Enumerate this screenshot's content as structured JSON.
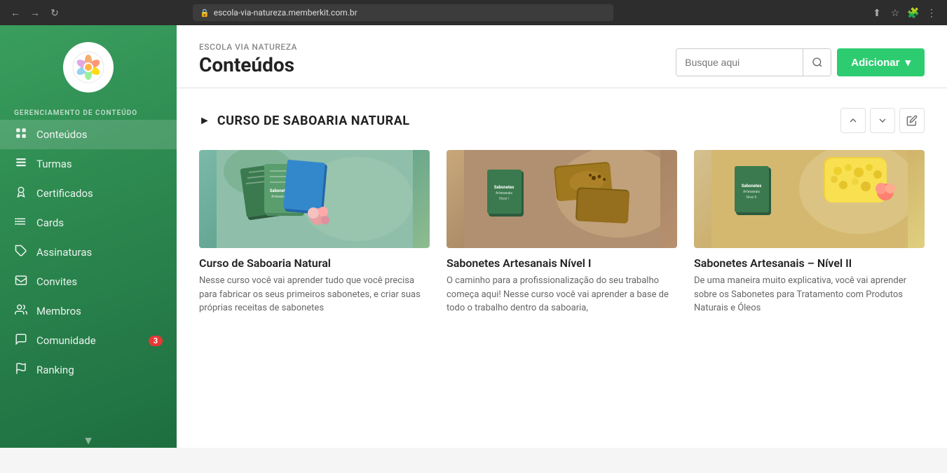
{
  "browser": {
    "url": "escola-via-natureza.memberkit.com.br",
    "lock_icon": "🔒"
  },
  "sidebar": {
    "section_label": "GERENCIAMENTO DE CONTEÚDO",
    "logo_alt": "Via Natureza",
    "nav_items": [
      {
        "id": "conteudos",
        "label": "Conteúdos",
        "icon": "grid",
        "active": true,
        "badge": null
      },
      {
        "id": "turmas",
        "label": "Turmas",
        "icon": "list",
        "active": false,
        "badge": null
      },
      {
        "id": "certificados",
        "label": "Certificados",
        "icon": "award",
        "active": false,
        "badge": null
      },
      {
        "id": "cards",
        "label": "Cards",
        "icon": "users2",
        "active": false,
        "badge": null
      },
      {
        "id": "assinaturas",
        "label": "Assinaturas",
        "icon": "tag",
        "active": false,
        "badge": null
      },
      {
        "id": "convites",
        "label": "Convites",
        "icon": "mail",
        "active": false,
        "badge": null
      },
      {
        "id": "membros",
        "label": "Membros",
        "icon": "people",
        "active": false,
        "badge": null
      },
      {
        "id": "comunidade",
        "label": "Comunidade",
        "icon": "chat",
        "active": false,
        "badge": "3"
      },
      {
        "id": "ranking",
        "label": "Ranking",
        "icon": "flag",
        "active": false,
        "badge": null
      }
    ]
  },
  "header": {
    "school_name": "ESCOLA VIA NATUREZA",
    "page_title": "Conteúdos",
    "search_placeholder": "Busque aqui",
    "add_button_label": "Adicionar"
  },
  "section": {
    "title": "CURSO DE SABOARIA NATURAL",
    "up_label": "↑",
    "down_label": "↓",
    "edit_label": "✎"
  },
  "courses": [
    {
      "id": "course1",
      "title": "Curso de Saboaria Natural",
      "description": "Nesse curso você vai aprender tudo que você precisa para fabricar os seus primeiros sabonetes, e criar suas próprias receitas de sabonetes",
      "card_color": "card1"
    },
    {
      "id": "course2",
      "title": "Sabonetes Artesanais Nível I",
      "description": "O caminho para a profissionalização do seu trabalho começa aqui! Nesse curso você vai aprender a base de todo o trabalho dentro da saboaria,",
      "card_color": "card2"
    },
    {
      "id": "course3",
      "title": "Sabonetes Artesanais – Nível II",
      "description": "De uma maneira muito explicativa, você vai aprender sobre os Sabonetes para Tratamento com Produtos Naturais e Óleos",
      "card_color": "card3"
    }
  ]
}
